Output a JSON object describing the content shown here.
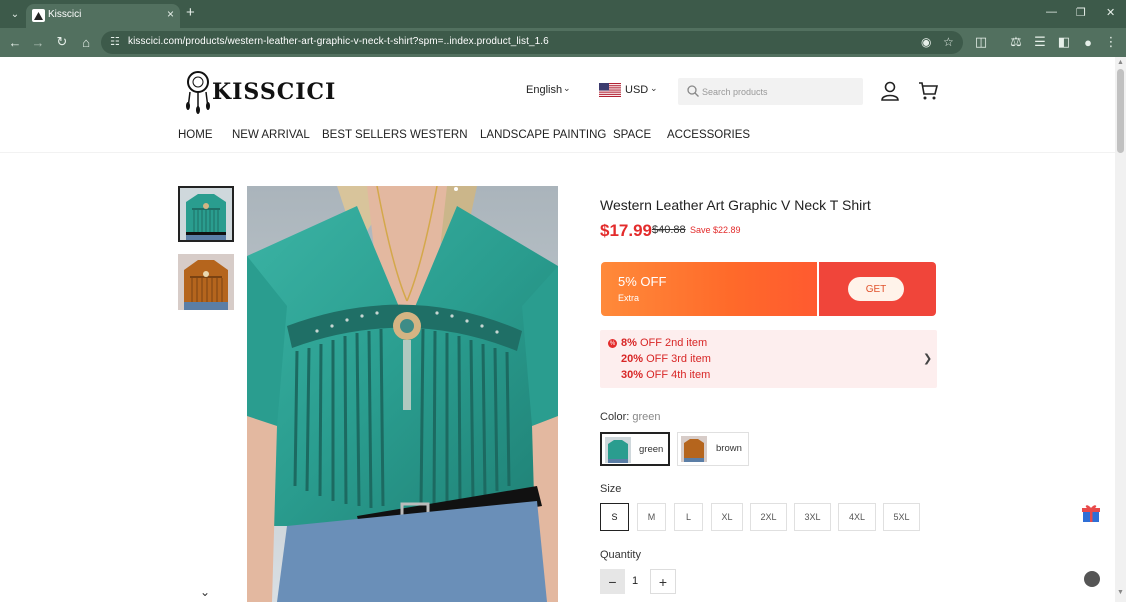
{
  "browser": {
    "tab_title": "Kisscici",
    "url": "kisscici.com/products/western-leather-art-graphic-v-neck-t-shirt?spm=..index.product_list_1.6"
  },
  "header": {
    "logo_text": "KISSCICI",
    "language": "English",
    "currency": "USD",
    "search_placeholder": "Search products"
  },
  "nav": {
    "items": [
      "HOME",
      "NEW ARRIVAL",
      "BEST SELLERS",
      "WESTERN",
      "LANDSCAPE PAINTING",
      "SPACE",
      "ACCESSORIES"
    ]
  },
  "product": {
    "title": "Western Leather Art Graphic V Neck T Shirt",
    "price": "$17.99",
    "old_price": "$40.88",
    "save": "Save $22.89",
    "coupon": {
      "pct": "5% OFF",
      "sub": "Extra",
      "get": "GET"
    },
    "promo": {
      "lines": [
        {
          "pct": "8%",
          "rest": "OFF 2nd item"
        },
        {
          "pct": "20%",
          "rest": "OFF 3rd item"
        },
        {
          "pct": "30%",
          "rest": "OFF 4th item"
        }
      ]
    },
    "color_label": "Color:",
    "color_value": "green",
    "colors": [
      "green",
      "brown"
    ],
    "size_label": "Size",
    "sizes": [
      "S",
      "M",
      "L",
      "XL",
      "2XL",
      "3XL",
      "4XL",
      "5XL"
    ],
    "quantity_label": "Quantity",
    "quantity": "1"
  },
  "colors": {
    "accent_red": "#e32c2c",
    "browser_green": "#3d5a4a",
    "teal_shirt": "#2a9d8f",
    "brown_shirt": "#b5651d"
  }
}
